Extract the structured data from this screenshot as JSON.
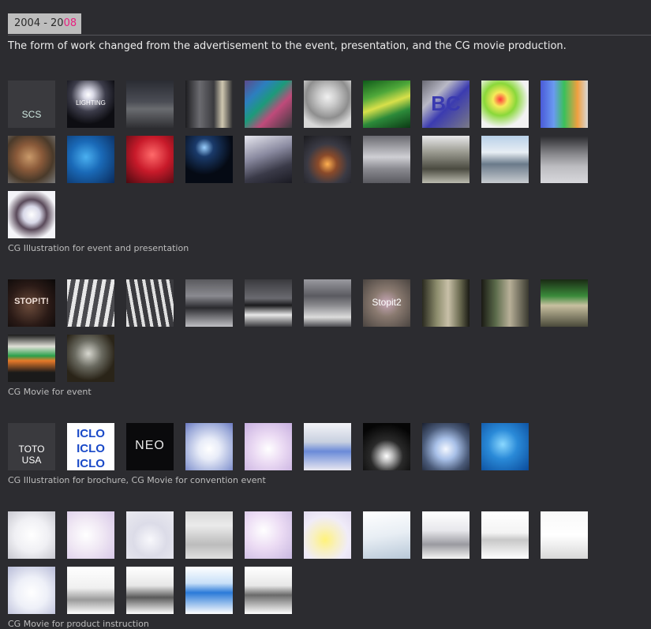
{
  "header": {
    "year_prefix": "2004 - 20",
    "year_highlight": "08",
    "accent_color": "#e8207f"
  },
  "intro": "The form of work changed from the advertisement to the event, presentation, and the CG movie production.",
  "sections": [
    {
      "caption": "CG Illustration for event and presentation",
      "thumbs": [
        {
          "style": "t-dark",
          "text": "SCS"
        },
        {
          "style": "t-spot",
          "text": "LIGHTING"
        },
        {
          "style": "t-room"
        },
        {
          "style": "t-room2"
        },
        {
          "style": "t-gallery"
        },
        {
          "style": "t-chess"
        },
        {
          "style": "t-wave"
        },
        {
          "style": "t-bc",
          "text": "BC"
        },
        {
          "style": "t-green"
        },
        {
          "style": "t-penguin"
        },
        {
          "style": "t-rust"
        },
        {
          "style": "t-blue"
        },
        {
          "style": "t-red"
        },
        {
          "style": "t-night"
        },
        {
          "style": "t-tent"
        },
        {
          "style": "t-robot"
        },
        {
          "style": "t-car1"
        },
        {
          "style": "t-car2"
        },
        {
          "style": "t-car3"
        },
        {
          "style": "t-car4"
        },
        {
          "style": "t-sphere"
        }
      ]
    },
    {
      "caption": "CG Movie for event",
      "thumbs": [
        {
          "style": "t-stopit",
          "text": "STOP!T!"
        },
        {
          "style": "t-street"
        },
        {
          "style": "t-street2"
        },
        {
          "style": "t-street3"
        },
        {
          "style": "t-street4"
        },
        {
          "style": "t-street5"
        },
        {
          "style": "t-stopit2",
          "text": "Stopit2"
        },
        {
          "style": "t-train"
        },
        {
          "style": "t-train2"
        },
        {
          "style": "t-train3"
        },
        {
          "style": "t-trainfront"
        },
        {
          "style": "t-skeleton"
        }
      ]
    },
    {
      "caption": "CG Illustration for brochure, CG Movie for convention event",
      "thumbs": [
        {
          "style": "t-toto",
          "text": "TOTO\nUSA"
        },
        {
          "style": "t-iclo",
          "text": "ICLO"
        },
        {
          "style": "t-neo",
          "text": "NEO"
        },
        {
          "style": "t-seat1"
        },
        {
          "style": "t-seat2"
        },
        {
          "style": "t-toilet"
        },
        {
          "style": "t-pillar"
        },
        {
          "style": "t-dome"
        },
        {
          "style": "t-water"
        }
      ]
    },
    {
      "caption": "CG Movie for product instruction",
      "thumbs": [
        {
          "style": "t-white1"
        },
        {
          "style": "t-white2"
        },
        {
          "style": "t-white3"
        },
        {
          "style": "t-panel"
        },
        {
          "style": "t-white4"
        },
        {
          "style": "t-yellow"
        },
        {
          "style": "t-white5"
        },
        {
          "style": "t-white6"
        },
        {
          "style": "t-white7"
        },
        {
          "style": "t-white8"
        },
        {
          "style": "t-seat3"
        },
        {
          "style": "t-pipe1"
        },
        {
          "style": "t-pipe2"
        },
        {
          "style": "t-pipe3"
        },
        {
          "style": "t-box"
        }
      ]
    }
  ]
}
